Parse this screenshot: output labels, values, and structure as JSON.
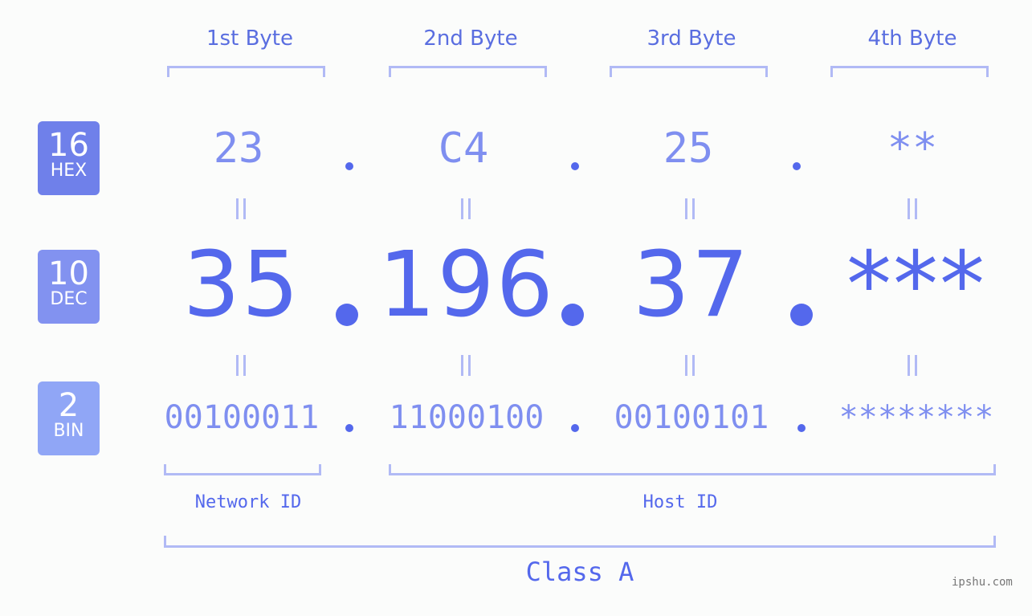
{
  "header": {
    "bytes": [
      "1st Byte",
      "2nd Byte",
      "3rd Byte",
      "4th Byte"
    ]
  },
  "badges": {
    "hex": {
      "num": "16",
      "unit": "HEX",
      "color": "#6f80ea"
    },
    "dec": {
      "num": "10",
      "unit": "DEC",
      "color": "#8292f0"
    },
    "bin": {
      "num": "2",
      "unit": "BIN",
      "color": "#90a6f6"
    }
  },
  "ip": {
    "hex": [
      "23",
      "C4",
      "25",
      "**"
    ],
    "dec": [
      "35",
      "196",
      "37",
      "***"
    ],
    "bin": [
      "00100011",
      "11000100",
      "00100101",
      "********"
    ],
    "separator": "."
  },
  "segments": {
    "network_id": "Network ID",
    "host_id": "Host ID",
    "class": "Class A"
  },
  "watermark": "ipshu.com",
  "colors": {
    "accent": "#5468ec",
    "light": "#7f8ff0",
    "bracket": "#b1baf5"
  }
}
